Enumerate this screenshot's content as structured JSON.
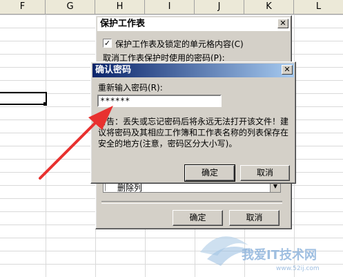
{
  "spreadsheet": {
    "columns": [
      "F",
      "G",
      "H",
      "I",
      "J",
      "K",
      "L"
    ]
  },
  "protect_dialog": {
    "title": "保护工作表",
    "close_glyph": "✕",
    "checkbox_mark": "✓",
    "protect_checkbox_label": "保护工作表及锁定的单元格内容(C)",
    "password_label": "取消工作表保护时使用的密码(P):",
    "list_item_label": "删除列",
    "ok_label": "确定",
    "cancel_label": "取消"
  },
  "confirm_dialog": {
    "title": "确认密码",
    "close_glyph": "✕",
    "reenter_label": "重新输入密码(R):",
    "password_value": "******",
    "warning_text": "警告：丢失或忘记密码后将永远无法打开该文件！建议将密码及其相应工作簿和工作表名称的列表保存在安全的地方(注意，密码区分大小写)。",
    "ok_label": "确定",
    "cancel_label": "取消"
  },
  "watermark": {
    "text": "我爱IT技术网",
    "subtext": "www.52ij.com"
  },
  "colors": {
    "titlebar_active": "#0a246a",
    "dialog_face": "#d4d0c8",
    "arrow": "#e8312f"
  }
}
